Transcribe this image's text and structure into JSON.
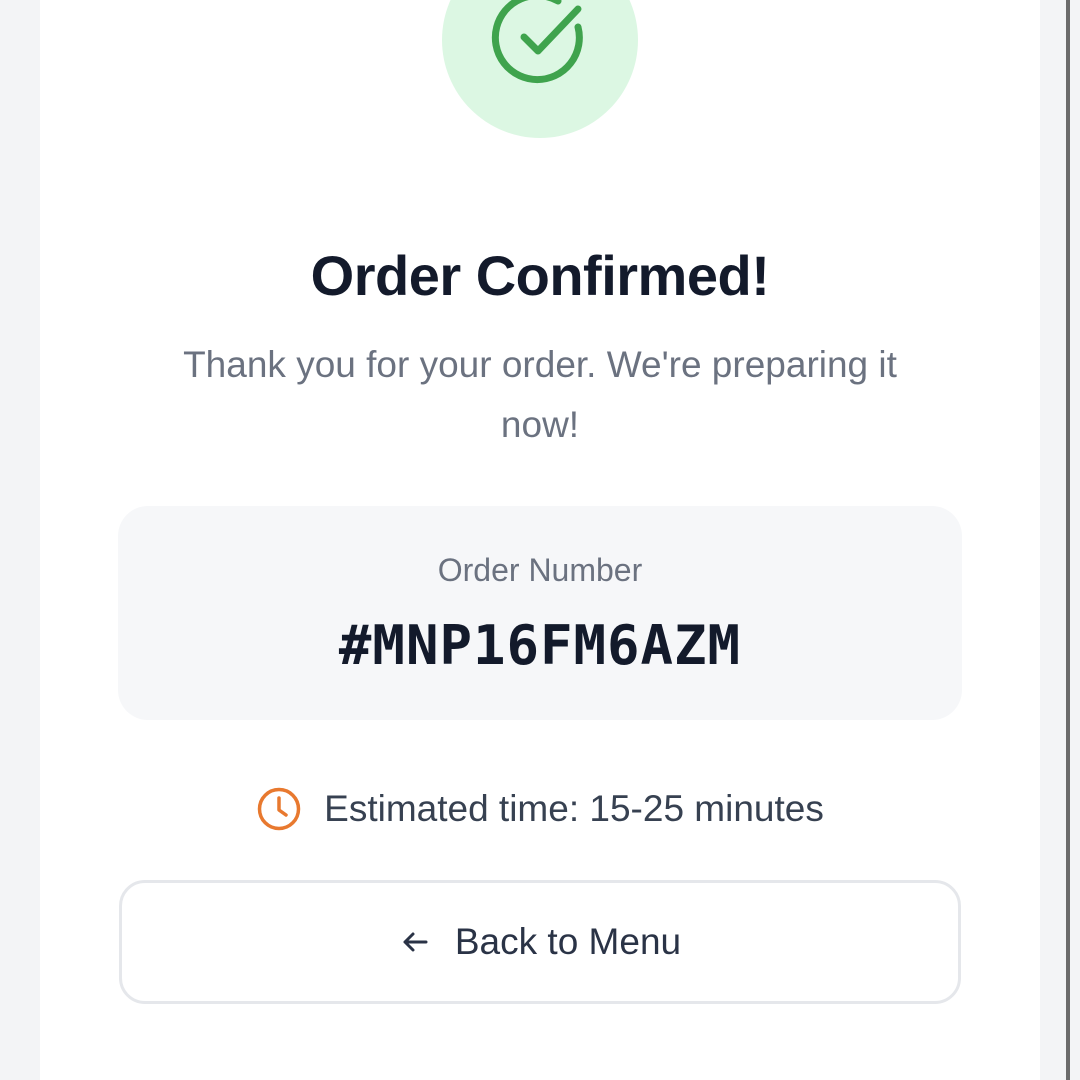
{
  "confirmation": {
    "title": "Order Confirmed!",
    "message": "Thank you for your order. We're preparing it now!",
    "icon": "check-circle-icon"
  },
  "order": {
    "label": "Order Number",
    "number": "#MNP16FM6AZM"
  },
  "eta": {
    "icon": "clock-icon",
    "text": "Estimated time: 15-25 minutes"
  },
  "actions": {
    "back_label": "Back to Menu",
    "back_icon": "arrow-left-icon"
  },
  "colors": {
    "success": "#3fa34d",
    "success_bg": "#dcf7e3",
    "accent_orange": "#e8792f",
    "heading": "#131a2b",
    "muted": "#6b7280",
    "surface": "#f6f7f9",
    "border": "#e5e7eb"
  }
}
